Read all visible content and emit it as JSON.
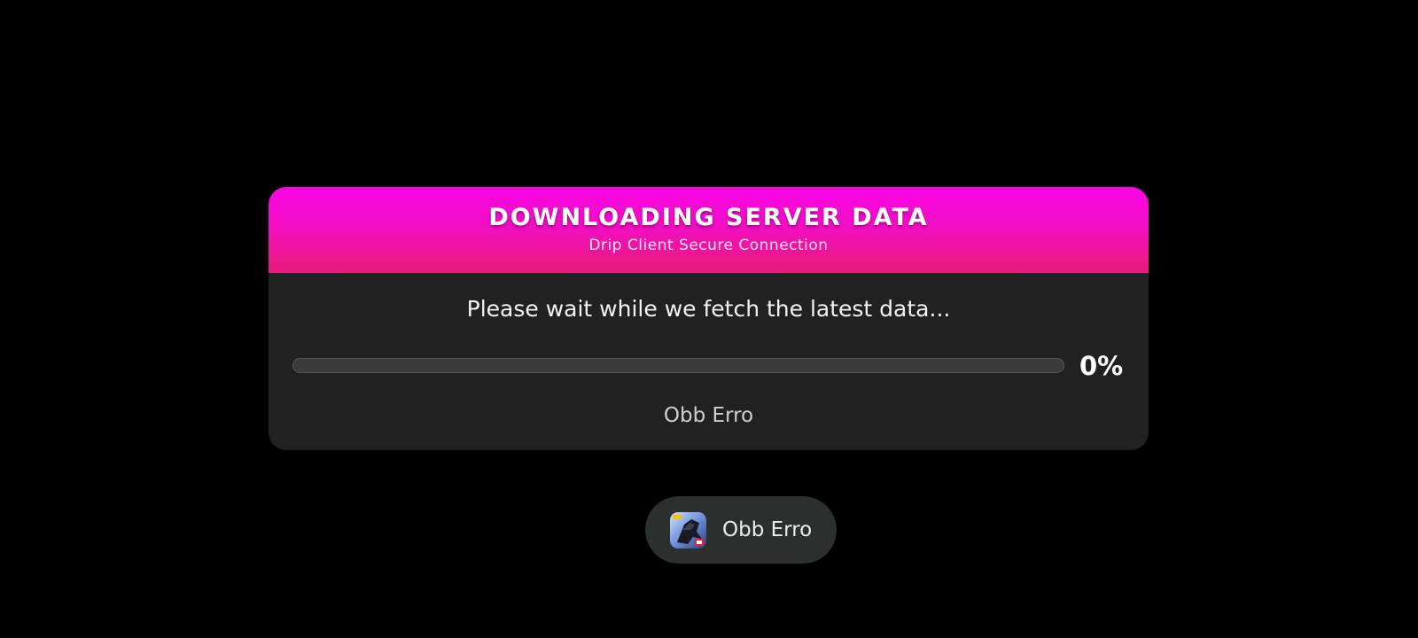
{
  "dialog": {
    "title": "DOWNLOADING SERVER DATA",
    "subtitle": "Drip Client Secure Connection",
    "message": "Please wait while we fetch the latest data...",
    "progress": {
      "value": 0,
      "label": "0%"
    },
    "status": "Obb Erro",
    "colors": {
      "header_top": "#fa05e6",
      "header_bottom": "#e91a78",
      "body": "#212121"
    }
  },
  "toast": {
    "icon": "app-icon",
    "text": "Obb Erro"
  }
}
